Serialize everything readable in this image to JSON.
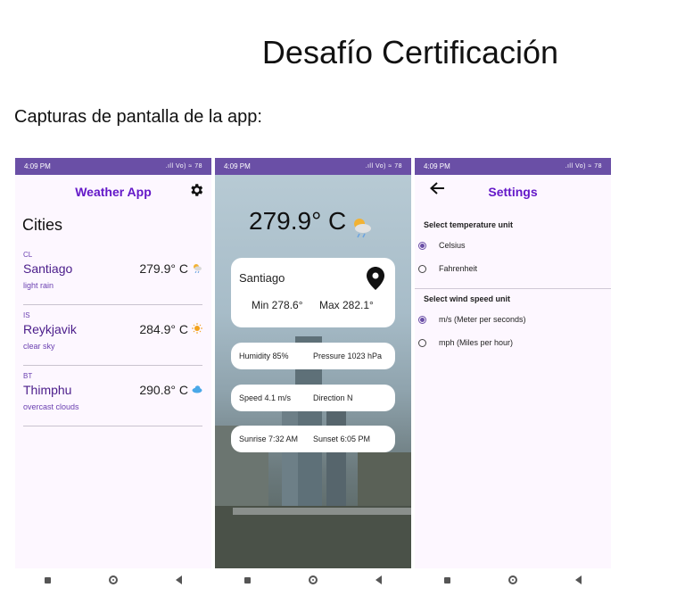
{
  "document": {
    "title": "Desafío Certificación",
    "subtitle": "Capturas de pantalla de la app:"
  },
  "status_bar": {
    "time": "4:09 PM",
    "indicators": ".ıll Vo) ≈ 78"
  },
  "home": {
    "app_title": "Weather App",
    "section_title": "Cities",
    "cities": [
      {
        "code": "CL",
        "name": "Santiago",
        "temp": "279.9° C",
        "desc": "light rain",
        "icon": "sun-cloud-rain-icon"
      },
      {
        "code": "IS",
        "name": "Reykjavik",
        "temp": "284.9° C",
        "desc": "clear sky",
        "icon": "sun-icon"
      },
      {
        "code": "BT",
        "name": "Thimphu",
        "temp": "290.8° C",
        "desc": "overcast clouds",
        "icon": "cloud-icon"
      }
    ]
  },
  "detail": {
    "temp": "279.9° C",
    "city": "Santiago",
    "min": "Min 278.6°",
    "max": "Max 282.1°",
    "humidity": "Humidity 85%",
    "pressure": "Pressure 1023 hPa",
    "speed": "Speed 4.1 m/s",
    "direction": "Direction N",
    "sunrise": "Sunrise 7:32 AM",
    "sunset": "Sunset 6:05 PM"
  },
  "settings": {
    "title": "Settings",
    "temp_section": "Select temperature unit",
    "temp_options": [
      "Celsius",
      "Fahrenheit"
    ],
    "temp_selected": "Celsius",
    "wind_section": "Select wind speed unit",
    "wind_options": [
      "m/s (Meter per seconds)",
      "mph (Miles per hour)"
    ],
    "wind_selected": "m/s (Meter per seconds)"
  },
  "colors": {
    "accent": "#6419c8",
    "status_bar": "#6a4fa6",
    "background": "#fdf7ff"
  }
}
